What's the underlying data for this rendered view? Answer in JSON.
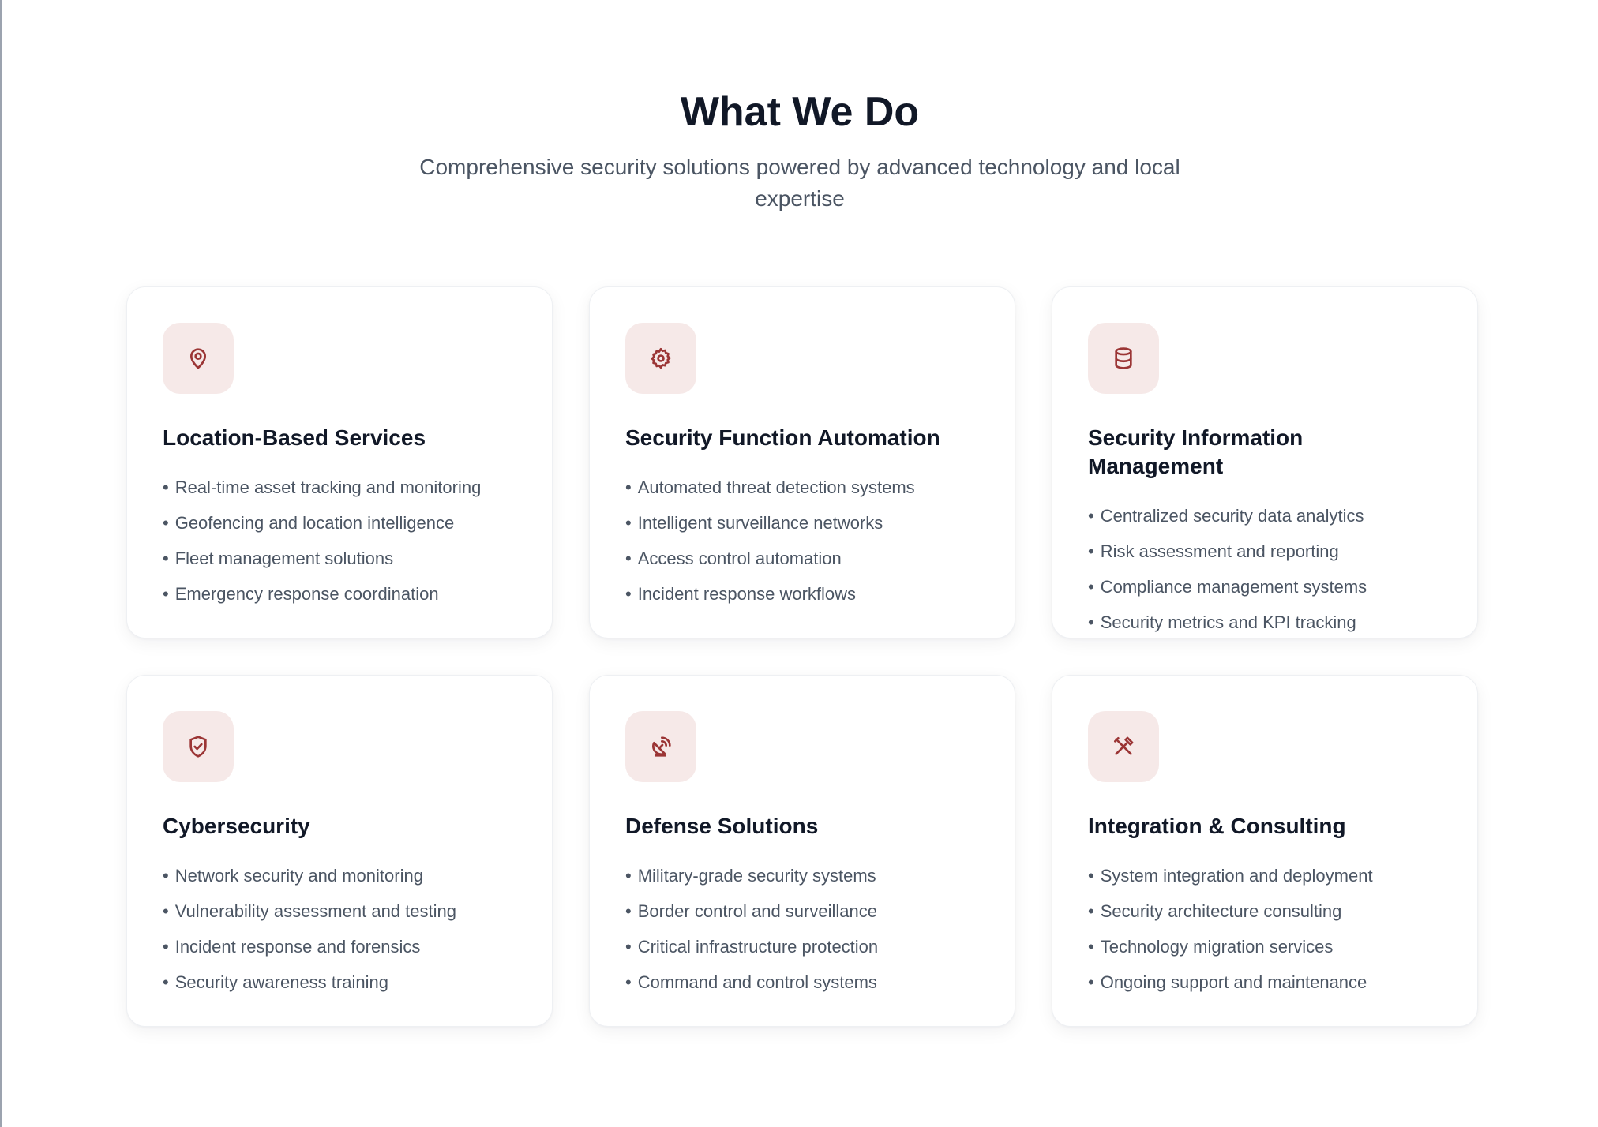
{
  "header": {
    "title": "What We Do",
    "subtitle": "Comprehensive security solutions powered by advanced technology and local expertise"
  },
  "colors": {
    "accent": "#9b3535",
    "icon_bg": "#f6e9e8",
    "heading": "#111827",
    "body_text": "#4b5563"
  },
  "services": [
    {
      "icon": "map-pin-icon",
      "title": "Location-Based Services",
      "items": [
        "Real-time asset tracking and monitoring",
        "Geofencing and location intelligence",
        "Fleet management solutions",
        "Emergency response coordination"
      ]
    },
    {
      "icon": "gear-icon",
      "title": "Security Function Automation",
      "items": [
        "Automated threat detection systems",
        "Intelligent surveillance networks",
        "Access control automation",
        "Incident response workflows"
      ]
    },
    {
      "icon": "database-icon",
      "title": "Security Information Management",
      "items": [
        "Centralized security data analytics",
        "Risk assessment and reporting",
        "Compliance management systems",
        "Security metrics and KPI tracking"
      ]
    },
    {
      "icon": "shield-check-icon",
      "title": "Cybersecurity",
      "items": [
        "Network security and monitoring",
        "Vulnerability assessment and testing",
        "Incident response and forensics",
        "Security awareness training"
      ]
    },
    {
      "icon": "satellite-dish-icon",
      "title": "Defense Solutions",
      "items": [
        "Military-grade security systems",
        "Border control and surveillance",
        "Critical infrastructure protection",
        "Command and control systems"
      ]
    },
    {
      "icon": "tools-icon",
      "title": "Integration & Consulting",
      "items": [
        "System integration and deployment",
        "Security architecture consulting",
        "Technology migration services",
        "Ongoing support and maintenance"
      ]
    }
  ]
}
